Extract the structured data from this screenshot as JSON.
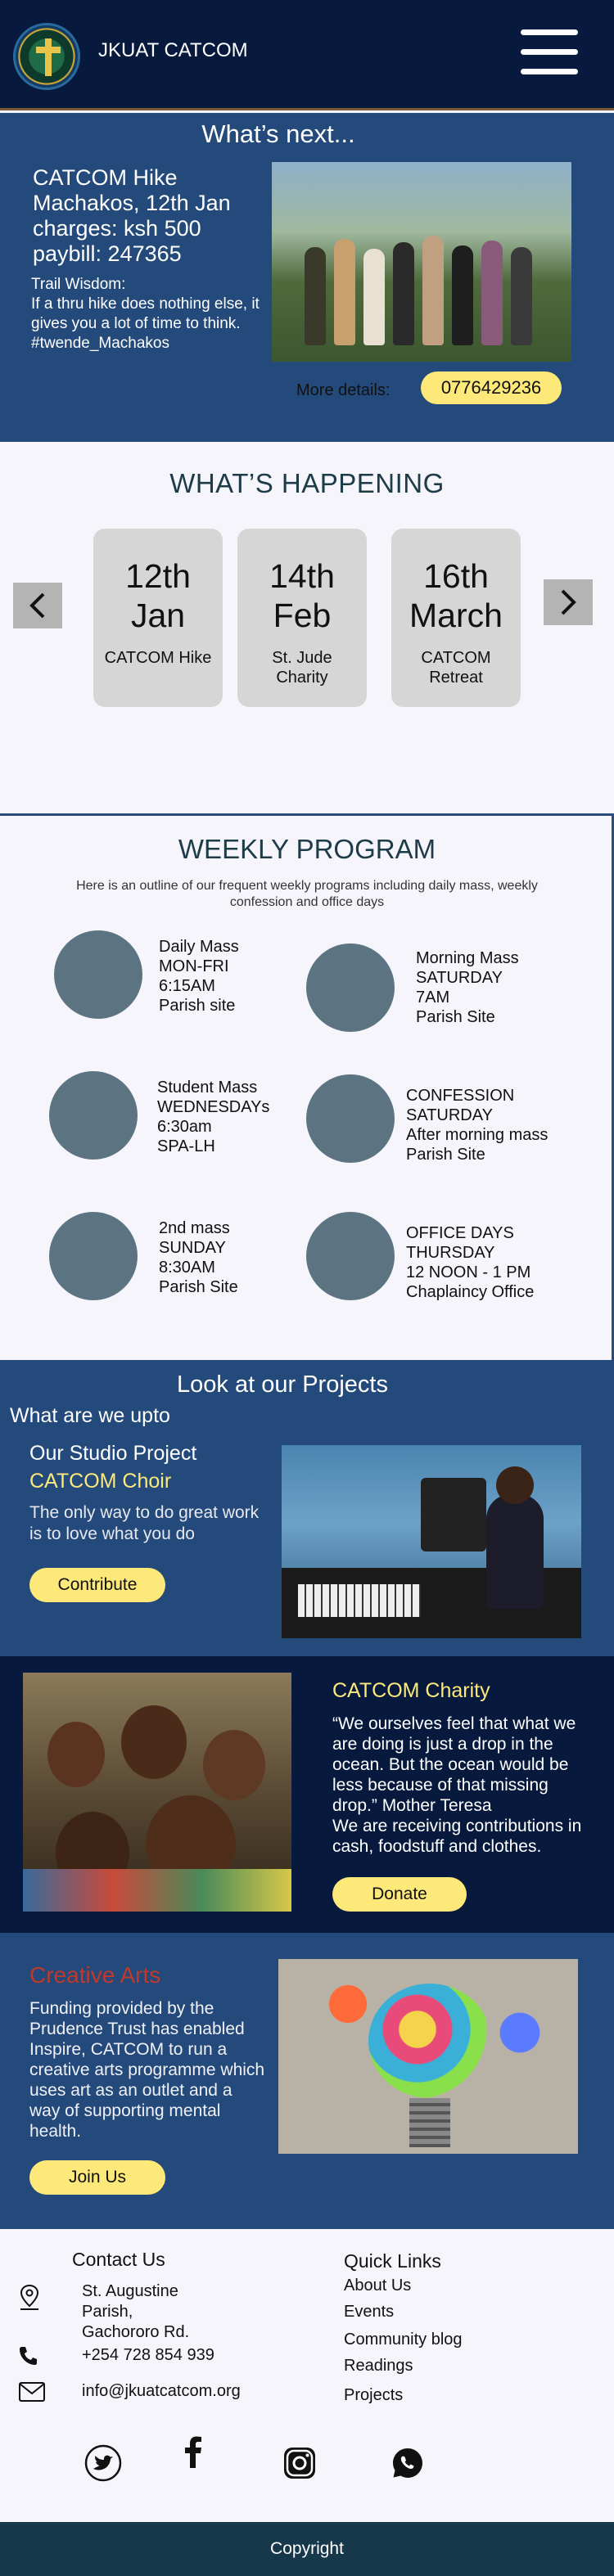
{
  "header": {
    "brand": "JKUAT CATCOM",
    "logo_icon": "parish-crest-logo",
    "menu_icon": "hamburger-menu-icon"
  },
  "next": {
    "title": "What’s next...",
    "event_lines": [
      "CATCOM Hike",
      "Machakos, 12th Jan",
      "charges: ksh 500",
      "paybill: 247365"
    ],
    "trail_lines": [
      "Trail Wisdom:",
      "If a thru hike does nothing else, it gives you a lot of time to think.",
      "#twende_Machakos"
    ],
    "more_label": "More details:",
    "phone": "0776429236"
  },
  "happening": {
    "title": "WHAT’S HAPPENING",
    "events": [
      {
        "date": "12th\nJan",
        "name": "CATCOM Hike"
      },
      {
        "date": "14th\nFeb",
        "name": "St. Jude Charity"
      },
      {
        "date": "16th\nMarch",
        "name": "CATCOM Retreat"
      }
    ]
  },
  "weekly": {
    "title": "WEEKLY PROGRAM",
    "description": "Here is an outline of our frequent weekly programs including daily mass, weekly confession and office days",
    "programs": [
      "Daily Mass\nMON-FRI\n6:15AM\nParish site",
      "Morning Mass\nSATURDAY\n7AM\nParish Site",
      "Student Mass\nWEDNESDAYs\n6:30am\nSPA-LH",
      "CONFESSION\nSATURDAY\nAfter morning mass\nParish Site",
      "2nd  mass\nSUNDAY\n8:30AM\nParish Site",
      "OFFICE DAYS\nTHURSDAY\n12 NOON - 1 PM\nChaplaincy Office"
    ]
  },
  "projects": {
    "title": "Look at our Projects",
    "subtitle": "What are we upto",
    "studio_label": "Our Studio Project",
    "choir_label": "CATCOM Choir",
    "quote": "The only way to do great work is to love what you do",
    "button": "Contribute"
  },
  "charity": {
    "title": "CATCOM Charity",
    "text": "“We ourselves feel that what we are doing is just a drop in the ocean. But the ocean would be less because of that missing drop.” Mother Teresa\nWe are receiving contributions in cash, foodstuff and clothes.",
    "button": "Donate"
  },
  "arts": {
    "title": "Creative Arts",
    "text": "Funding provided by the Prudence Trust has enabled Inspire, CATCOM to run a creative arts programme which uses art as an outlet and a way of supporting mental health.",
    "button": "Join Us"
  },
  "footer": {
    "contact_title": "Contact Us",
    "address": "St. Augustine\nParish,\nGachororo Rd.",
    "phone": "+254 728 854 939",
    "email": "info@jkuatcatcom.org",
    "links_title": "Quick Links",
    "links": [
      "About Us",
      "Events",
      "Community blog",
      "Readings",
      "Projects"
    ],
    "social_icons": [
      "twitter-icon",
      "facebook-icon",
      "instagram-icon",
      "whatsapp-icon"
    ],
    "copyright": "Copyright"
  },
  "colors": {
    "navy": "#071a3d",
    "blue": "#234a7a",
    "accent_yellow": "#fde87a",
    "arts_red": "#c0392b",
    "heading_teal": "#1d3c48"
  }
}
